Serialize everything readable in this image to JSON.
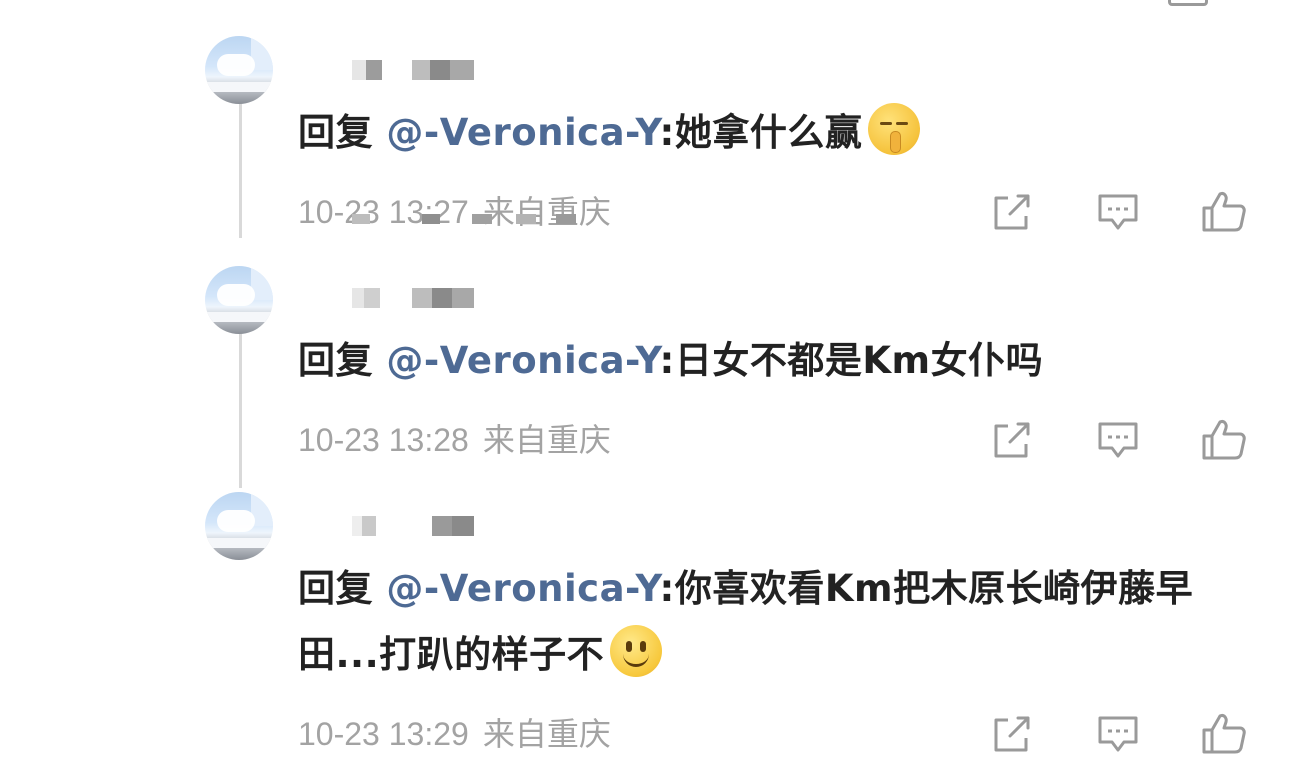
{
  "replies": [
    {
      "content_prefix": "回复",
      "mention": "@-Veronica-Y",
      "content_text": ":她拿什么赢",
      "content_emoji": "shushing-face-emoji",
      "timestamp": "10-23 13:27",
      "location": "来自重庆"
    },
    {
      "content_prefix": "回复",
      "mention": "@-Veronica-Y",
      "content_text": ":日女不都是Km女仆吗",
      "timestamp": "10-23 13:28",
      "location": "来自重庆"
    },
    {
      "content_prefix": "回复",
      "mention": "@-Veronica-Y",
      "content_text": ":你喜欢看Km把木原长崎伊藤早田...打趴的样子不",
      "content_emoji": "smiling-face-emoji",
      "timestamp": "10-23 13:29",
      "location": "来自重庆"
    }
  ],
  "icons": {
    "share": "share-icon",
    "comment": "comment-icon",
    "like": "like-icon"
  },
  "colors": {
    "mention": "#4e6a94",
    "meta": "#a3a3a3",
    "icon": "#9a9a9a",
    "thread_line": "#d9d9d9"
  }
}
